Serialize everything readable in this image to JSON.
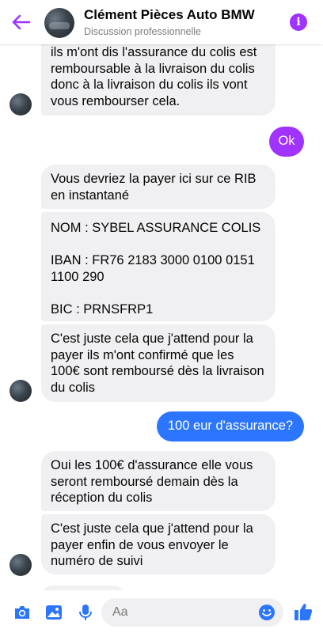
{
  "header": {
    "title": "Clément Pièces Auto BMW",
    "subtitle": "Discussion professionnelle",
    "info_glyph": "i"
  },
  "messages": [
    {
      "from": "contact",
      "text": "ils m'ont dis l'assurance du colis est remboursable à la livraison du colis donc à la livraison du colis ils vont vous rembourser cela."
    },
    {
      "from": "me",
      "text": "Ok"
    },
    {
      "from": "contact",
      "text": "Vous devriez la payer ici sur ce RIB en instantané"
    },
    {
      "from": "contact",
      "text": "NOM : SYBEL ASSURANCE COLIS\n\nIBAN : FR76 2183 3000 0100 0151 1100 290\n\nBIC : PRNSFRP1"
    },
    {
      "from": "contact",
      "text": "C'est juste cela que j'attend pour la payer ils m'ont confirmé que les 100€ sont remboursé dès la livraison du colis"
    },
    {
      "from": "me",
      "text": "100 eur d'assurance?"
    },
    {
      "from": "contact",
      "text": "Oui les 100€ d'assurance elle vous seront remboursé demain dès la réception du colis"
    },
    {
      "from": "contact",
      "text": "C'est juste cela que j'attend pour la payer enfin de vous envoyer le numéro de suivi"
    }
  ],
  "composer": {
    "placeholder": "Aa",
    "icons": [
      "camera-icon",
      "gallery-icon",
      "microphone-icon",
      "emoji-icon",
      "like-icon"
    ]
  },
  "colors": {
    "accent": "#a033ff",
    "outgoing_blue": "#2c76ff",
    "incoming_bg": "#f0f0f2",
    "composer_icon": "#2c76ff"
  }
}
